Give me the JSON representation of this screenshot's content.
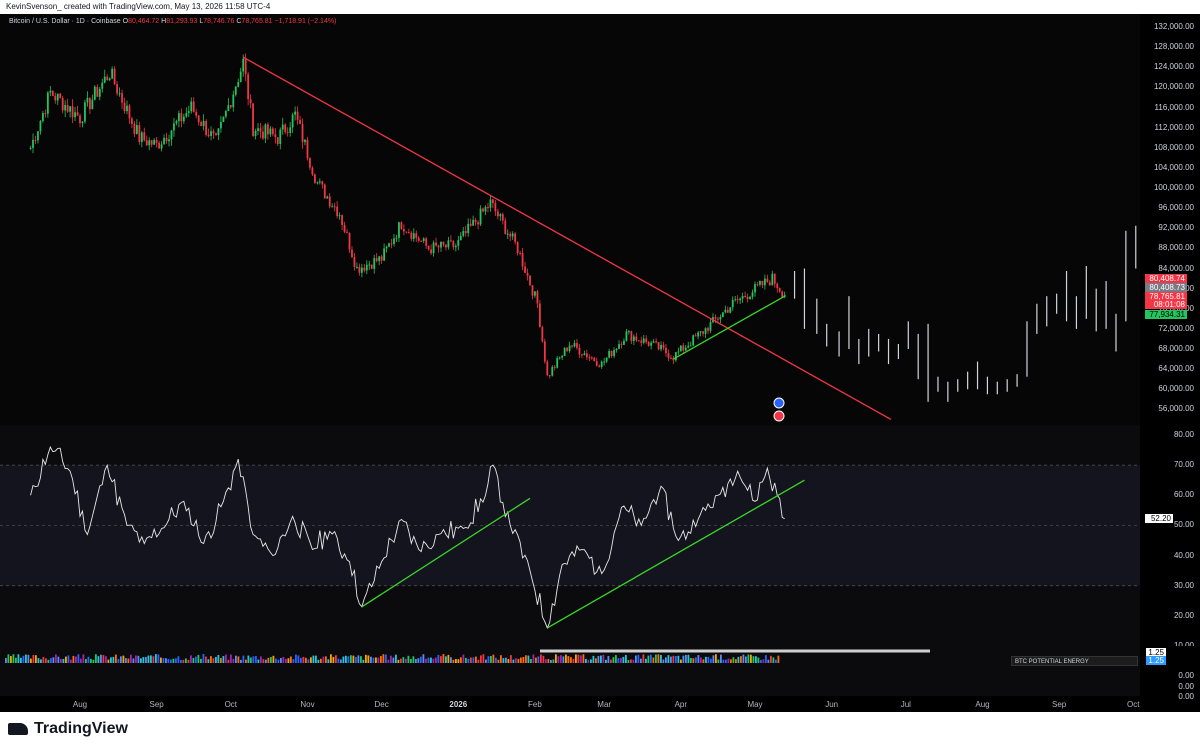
{
  "header": {
    "text": "KevinSvenson_ created with TradingView.com, May 13, 2026 11:58 UTC-4"
  },
  "symbol": {
    "name": "Bitcoin / U.S. Dollar · 1D · Coinbase",
    "o_label": "O",
    "o_value": "80,464.72",
    "h_label": "H",
    "h_value": "81,293.93",
    "l_label": "L",
    "l_value": "78,746.76",
    "c_label": "C",
    "c_value": "78,765.81 −1,718.91 (−2.14%)"
  },
  "price_axis": [
    "132,000.00",
    "128,000.00",
    "124,000.00",
    "120,000.00",
    "116,000.00",
    "112,000.00",
    "108,000.00",
    "104,000.00",
    "100,000.00",
    "96,000.00",
    "92,000.00",
    "88,000.00",
    "84,000.00",
    "80,000.00",
    "76,000.00",
    "72,000.00",
    "68,000.00",
    "64,000.00",
    "60,000.00",
    "56,000.00"
  ],
  "price_tags": [
    {
      "text": "80,408.74",
      "bg": "#f23645",
      "fg": "#ffffff"
    },
    {
      "text": "80,408.73",
      "bg": "#787b86",
      "fg": "#ffffff"
    },
    {
      "text": "78,765.81",
      "bg": "#f23645",
      "fg": "#ffffff"
    },
    {
      "text": "08:01:08",
      "bg": "#f23645",
      "fg": "#ffffff"
    },
    {
      "text": "77,934.31",
      "bg": "#22c55e",
      "fg": "#000000"
    }
  ],
  "rsi_axis": [
    "80.00",
    "70.00",
    "60.00",
    "50.00",
    "40.00",
    "30.00",
    "20.00",
    "10.00"
  ],
  "rsi_tag": {
    "text": "52.20",
    "bg": "#ffffff",
    "fg": "#000000"
  },
  "pe_axis": [
    "1.25",
    "1.25",
    "0.00",
    "0.00",
    "0.00"
  ],
  "pe_label": "BTC POTENTIAL ENERGY",
  "months": [
    "Aug",
    "Sep",
    "Oct",
    "Nov",
    "Dec",
    "2026",
    "Feb",
    "Mar",
    "Apr",
    "May",
    "Jun",
    "Jul",
    "Aug",
    "Sep",
    "Oct"
  ],
  "footer": {
    "brand": "TradingView"
  },
  "colors": {
    "up": "#22c55e",
    "down": "#f23645",
    "trend_red": "#f23645",
    "trend_green": "#39d827",
    "projection": "#d1d4dc",
    "rsi_line": "#e8e8e8"
  },
  "chart_data": [
    {
      "type": "candlestick",
      "title": "Bitcoin / U.S. Dollar · 1D · Coinbase",
      "ylim": [
        54000,
        134000
      ],
      "x_ticks": [
        "Aug",
        "Sep",
        "Oct",
        "Nov",
        "Dec",
        "2026",
        "Feb",
        "Mar",
        "Apr",
        "May",
        "Jun",
        "Jul",
        "Aug",
        "Sep",
        "Oct"
      ],
      "price_path": [
        {
          "date": "2025-07-12",
          "close": 108000
        },
        {
          "date": "2025-07-20",
          "close": 119000
        },
        {
          "date": "2025-08-01",
          "close": 114000
        },
        {
          "date": "2025-08-13",
          "close": 123000
        },
        {
          "date": "2025-08-25",
          "close": 110000
        },
        {
          "date": "2025-09-01",
          "close": 108500
        },
        {
          "date": "2025-09-15",
          "close": 116000
        },
        {
          "date": "2025-09-25",
          "close": 109000
        },
        {
          "date": "2025-10-06",
          "close": 125000
        },
        {
          "date": "2025-10-10",
          "close": 112000
        },
        {
          "date": "2025-10-20",
          "close": 110000
        },
        {
          "date": "2025-10-27",
          "close": 114500
        },
        {
          "date": "2025-11-05",
          "close": 101000
        },
        {
          "date": "2025-11-14",
          "close": 95000
        },
        {
          "date": "2025-11-21",
          "close": 84000
        },
        {
          "date": "2025-12-01",
          "close": 86000
        },
        {
          "date": "2025-12-09",
          "close": 93000
        },
        {
          "date": "2025-12-20",
          "close": 88000
        },
        {
          "date": "2025-12-31",
          "close": 88500
        },
        {
          "date": "2026-01-14",
          "close": 97000
        },
        {
          "date": "2026-01-25",
          "close": 88000
        },
        {
          "date": "2026-02-02",
          "close": 77000
        },
        {
          "date": "2026-02-06",
          "close": 62500
        },
        {
          "date": "2026-02-15",
          "close": 69000
        },
        {
          "date": "2026-02-28",
          "close": 65000
        },
        {
          "date": "2026-03-10",
          "close": 71000
        },
        {
          "date": "2026-03-20",
          "close": 69000
        },
        {
          "date": "2026-03-29",
          "close": 66500
        },
        {
          "date": "2026-04-10",
          "close": 71500
        },
        {
          "date": "2026-04-22",
          "close": 77000
        },
        {
          "date": "2026-05-03",
          "close": 80500
        },
        {
          "date": "2026-05-08",
          "close": 82000
        },
        {
          "date": "2026-05-13",
          "close": 78766
        }
      ],
      "trendlines": [
        {
          "color": "red",
          "from": {
            "date": "2025-10-06",
            "price": 126000
          },
          "to": {
            "date": "2026-06-25",
            "price": 54000
          }
        },
        {
          "color": "green",
          "from": {
            "date": "2026-03-29",
            "price": 66000
          },
          "to": {
            "date": "2026-05-13",
            "price": 78500
          }
        }
      ],
      "projection_bars": [
        {
          "date": "2026-05-17",
          "low": 78000,
          "high": 83500
        },
        {
          "date": "2026-05-21",
          "low": 72000,
          "high": 84000
        },
        {
          "date": "2026-05-26",
          "low": 71000,
          "high": 78000
        },
        {
          "date": "2026-05-30",
          "low": 68500,
          "high": 73000
        },
        {
          "date": "2026-06-04",
          "low": 66500,
          "high": 71500
        },
        {
          "date": "2026-06-08",
          "low": 68000,
          "high": 78500
        },
        {
          "date": "2026-06-12",
          "low": 65000,
          "high": 70000
        },
        {
          "date": "2026-06-16",
          "low": 66500,
          "high": 72000
        },
        {
          "date": "2026-06-20",
          "low": 67500,
          "high": 71000
        },
        {
          "date": "2026-06-24",
          "low": 65000,
          "high": 70000
        },
        {
          "date": "2026-06-28",
          "low": 66000,
          "high": 69000
        },
        {
          "date": "2026-07-02",
          "low": 68000,
          "high": 73500
        },
        {
          "date": "2026-07-06",
          "low": 62000,
          "high": 71000
        },
        {
          "date": "2026-07-10",
          "low": 57500,
          "high": 73000
        },
        {
          "date": "2026-07-14",
          "low": 59500,
          "high": 62500
        },
        {
          "date": "2026-07-18",
          "low": 57500,
          "high": 61500
        },
        {
          "date": "2026-07-22",
          "low": 59500,
          "high": 62000
        },
        {
          "date": "2026-07-26",
          "low": 60000,
          "high": 63500
        },
        {
          "date": "2026-07-30",
          "low": 60000,
          "high": 65500
        },
        {
          "date": "2026-08-03",
          "low": 59000,
          "high": 62500
        },
        {
          "date": "2026-08-07",
          "low": 59000,
          "high": 61500
        },
        {
          "date": "2026-08-11",
          "low": 59500,
          "high": 62000
        },
        {
          "date": "2026-08-15",
          "low": 60500,
          "high": 63000
        },
        {
          "date": "2026-08-19",
          "low": 62500,
          "high": 73500
        },
        {
          "date": "2026-08-23",
          "low": 71000,
          "high": 77000
        },
        {
          "date": "2026-08-27",
          "low": 72500,
          "high": 78500
        },
        {
          "date": "2026-08-31",
          "low": 75000,
          "high": 79000
        },
        {
          "date": "2026-09-04",
          "low": 73500,
          "high": 83500
        },
        {
          "date": "2026-09-08",
          "low": 72000,
          "high": 78500
        },
        {
          "date": "2026-09-12",
          "low": 74000,
          "high": 84500
        },
        {
          "date": "2026-09-16",
          "low": 71500,
          "high": 80000
        },
        {
          "date": "2026-09-20",
          "low": 72000,
          "high": 81500
        },
        {
          "date": "2026-09-24",
          "low": 67500,
          "high": 75000
        },
        {
          "date": "2026-09-28",
          "low": 73500,
          "high": 91500
        },
        {
          "date": "2026-10-02",
          "low": 84000,
          "high": 92500
        }
      ]
    },
    {
      "type": "line",
      "title": "RSI",
      "ylim": [
        10,
        80
      ],
      "bands": [
        70,
        50,
        30
      ],
      "last_value": 52.2,
      "series": [
        {
          "date": "2025-07-12",
          "value": 60
        },
        {
          "date": "2025-07-20",
          "value": 76
        },
        {
          "date": "2025-07-28",
          "value": 68
        },
        {
          "date": "2025-08-04",
          "value": 47
        },
        {
          "date": "2025-08-12",
          "value": 70
        },
        {
          "date": "2025-08-20",
          "value": 50
        },
        {
          "date": "2025-08-27",
          "value": 44
        },
        {
          "date": "2025-09-03",
          "value": 49
        },
        {
          "date": "2025-09-12",
          "value": 58
        },
        {
          "date": "2025-09-20",
          "value": 44
        },
        {
          "date": "2025-09-28",
          "value": 58
        },
        {
          "date": "2025-10-04",
          "value": 72
        },
        {
          "date": "2025-10-10",
          "value": 47
        },
        {
          "date": "2025-10-18",
          "value": 40
        },
        {
          "date": "2025-10-26",
          "value": 53
        },
        {
          "date": "2025-11-03",
          "value": 42
        },
        {
          "date": "2025-11-10",
          "value": 48
        },
        {
          "date": "2025-11-18",
          "value": 38
        },
        {
          "date": "2025-11-23",
          "value": 23
        },
        {
          "date": "2025-12-01",
          "value": 38
        },
        {
          "date": "2025-12-09",
          "value": 52
        },
        {
          "date": "2025-12-16",
          "value": 42
        },
        {
          "date": "2025-12-24",
          "value": 47
        },
        {
          "date": "2026-01-03",
          "value": 49
        },
        {
          "date": "2026-01-12",
          "value": 60
        },
        {
          "date": "2026-01-15",
          "value": 70
        },
        {
          "date": "2026-01-22",
          "value": 50
        },
        {
          "date": "2026-01-30",
          "value": 35
        },
        {
          "date": "2026-02-06",
          "value": 16
        },
        {
          "date": "2026-02-12",
          "value": 37
        },
        {
          "date": "2026-02-20",
          "value": 42
        },
        {
          "date": "2026-02-28",
          "value": 34
        },
        {
          "date": "2026-03-08",
          "value": 56
        },
        {
          "date": "2026-03-16",
          "value": 50
        },
        {
          "date": "2026-03-24",
          "value": 63
        },
        {
          "date": "2026-03-31",
          "value": 45
        },
        {
          "date": "2026-04-08",
          "value": 52
        },
        {
          "date": "2026-04-16",
          "value": 60
        },
        {
          "date": "2026-04-24",
          "value": 68
        },
        {
          "date": "2026-05-01",
          "value": 58
        },
        {
          "date": "2026-05-06",
          "value": 69
        },
        {
          "date": "2026-05-10",
          "value": 60
        },
        {
          "date": "2026-05-13",
          "value": 52.2
        }
      ],
      "trendlines": [
        {
          "color": "green",
          "from": {
            "date": "2025-11-23",
            "value": 23
          },
          "to": {
            "date": "2026-01-30",
            "value": 59
          }
        },
        {
          "color": "green",
          "from": {
            "date": "2026-02-06",
            "value": 16
          },
          "to": {
            "date": "2026-05-21",
            "value": 65
          }
        }
      ]
    },
    {
      "type": "bar",
      "title": "BTC POTENTIAL ENERGY",
      "last_value": 1.25
    }
  ]
}
